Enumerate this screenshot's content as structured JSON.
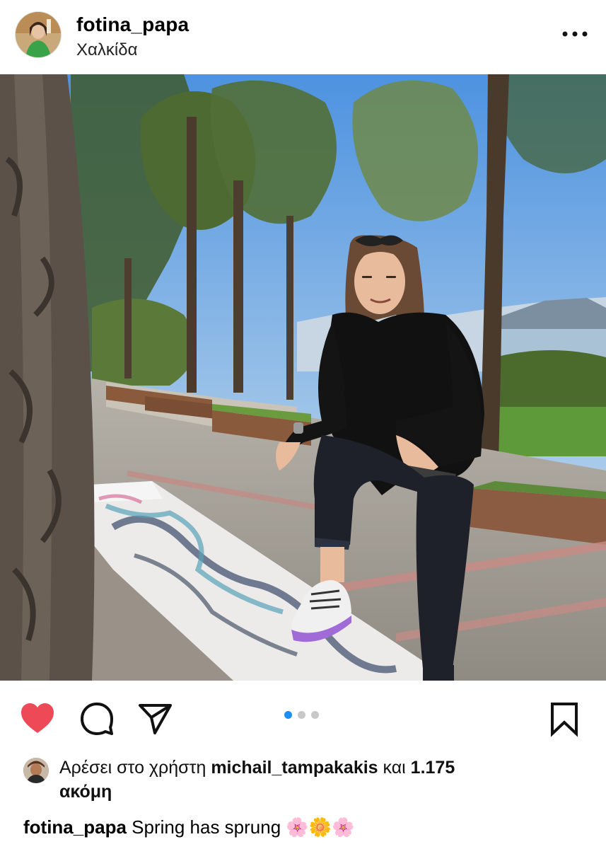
{
  "post": {
    "username": "fotina_papa",
    "location": "Χαλκίδα",
    "more_icon": "ellipsis-icon"
  },
  "actions": {
    "like_icon": "heart-filled-icon",
    "comment_icon": "comment-icon",
    "share_icon": "paper-plane-icon",
    "save_icon": "bookmark-icon",
    "like_color": "#ed4956"
  },
  "carousel": {
    "count": 3,
    "active_index": 0,
    "active_color": "#1d8ff1"
  },
  "likes": {
    "prefix": "Αρέσει στο χρήστη ",
    "user": "michail_tampakakis",
    "middle": " και ",
    "count": "1.175",
    "suffix": "ακόμη"
  },
  "caption": {
    "username": "fotina_papa",
    "text": " Spring has sprung 🌸🌼🌸"
  }
}
